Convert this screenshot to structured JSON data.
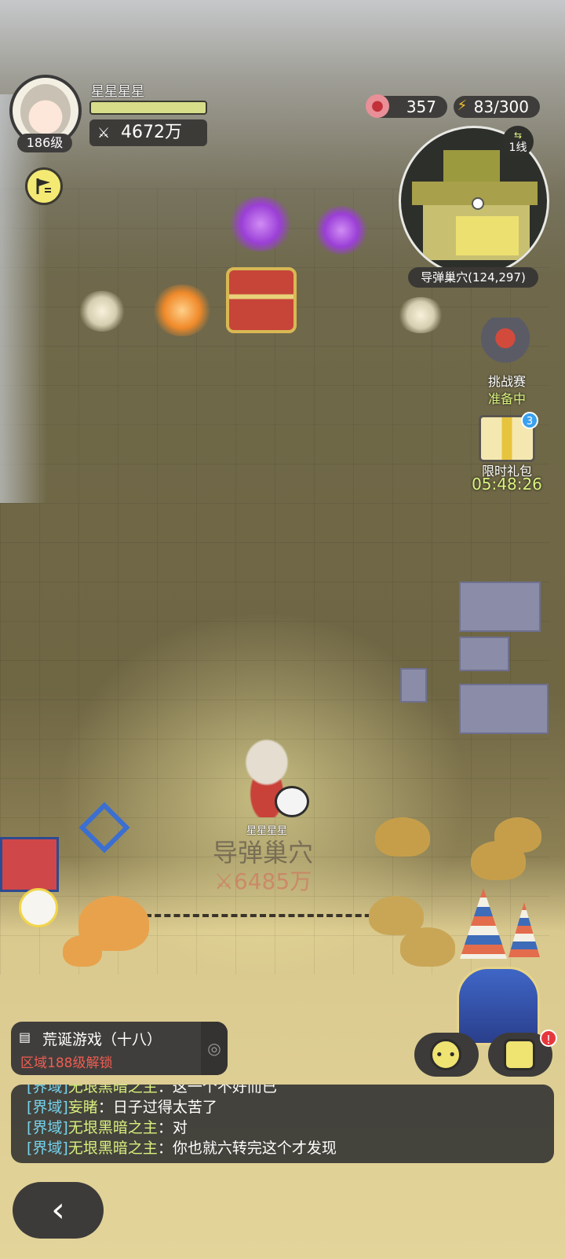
{
  "player": {
    "name": "星星星星",
    "level": "186级",
    "power": "4672万",
    "hp_fraction": 1.0
  },
  "resources": {
    "apples": "357",
    "energy": "83/300"
  },
  "minimap": {
    "line": "1线",
    "location": "导弹巢穴(124,297)"
  },
  "side": {
    "challenge_title": "挑战赛",
    "challenge_status": "准备中",
    "gift_title": "限时礼包",
    "gift_timer": "05:48:26",
    "gift_badge": "3"
  },
  "zone": {
    "owner": "星星星星",
    "name": "导弹巢穴",
    "power": "6485万"
  },
  "quest": {
    "title": "荒诞游戏（十八）",
    "requirement": "区域188级解锁"
  },
  "buttons": {
    "alert": "!",
    "back": "‹"
  },
  "chat": [
    {
      "channel": "[界域]",
      "name": "无垠黑暗之主",
      "sep": "：",
      "text": "这一个不好而已"
    },
    {
      "channel": "[界域]",
      "name": "妄睹",
      "sep": "：",
      "text": "日子过得太苦了"
    },
    {
      "channel": "[界域]",
      "name": "无垠黑暗之主",
      "sep": "：",
      "text": "对"
    },
    {
      "channel": "[界域]",
      "name": "无垠黑暗之主",
      "sep": "：",
      "text": "你也就六转完这个才发现"
    }
  ],
  "colors": {
    "accent_yellow": "#d9f27f",
    "chat_channel": "#74d3ec",
    "alert_red": "#f05d52"
  }
}
